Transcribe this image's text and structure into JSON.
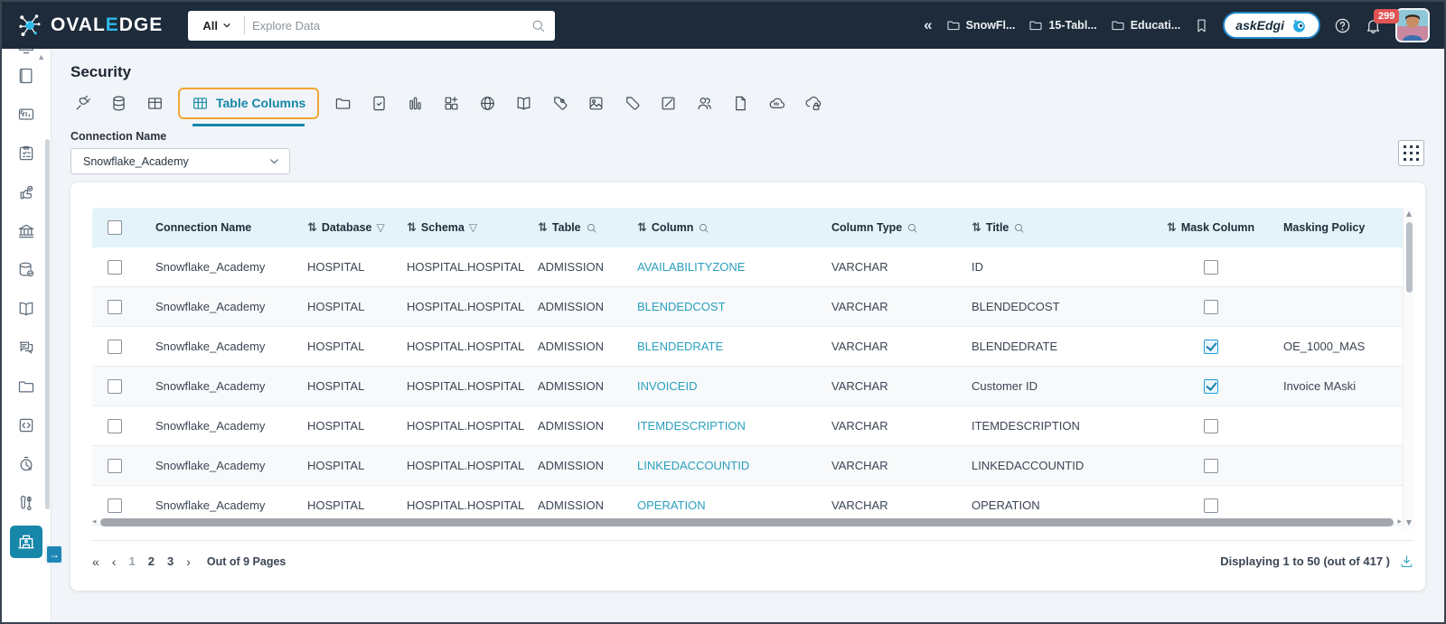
{
  "colors": {
    "accent_teal": "#1687a8",
    "link_teal": "#2a9fbe",
    "topbar_navy": "#1d2b3a",
    "badge_red": "#e25454",
    "annotation_orange": "#f0a632",
    "askedgi_blue": "#1e86c8"
  },
  "topbar": {
    "logo": {
      "part1": "OVAL",
      "accent": "E",
      "part2": "DGE"
    },
    "search": {
      "scope": "All",
      "placeholder": "Explore Data"
    },
    "collapse_glyph": "«",
    "recent": [
      {
        "label": "SnowFl..."
      },
      {
        "label": "15-Tabl..."
      },
      {
        "label": "Educati..."
      }
    ],
    "askedgi_label": "askEdgi",
    "notification_count": "299"
  },
  "sidebar": {
    "icons": [
      "monitor-partial",
      "journal",
      "report",
      "clipboard",
      "approval",
      "institution",
      "database-check",
      "book",
      "comments",
      "folder",
      "code",
      "scheduler",
      "tools",
      "security"
    ],
    "active_icon": "security"
  },
  "page": {
    "title": "Security"
  },
  "tabs": {
    "icons_before": [
      "crawler",
      "database",
      "table"
    ],
    "active": {
      "icon": "table-columns",
      "label": "Table Columns"
    },
    "icons_after": [
      "folder",
      "report-check",
      "bar-chart",
      "blocks-plus",
      "globe",
      "book",
      "tag-badge",
      "image",
      "tag",
      "note",
      "users",
      "file",
      "cloud-api",
      "cloud-lock"
    ]
  },
  "filter": {
    "label": "Connection Name",
    "value": "Snowflake_Academy"
  },
  "table": {
    "headers": {
      "connection": "Connection Name",
      "database": "Database",
      "schema": "Schema",
      "table": "Table",
      "column": "Column",
      "column_type": "Column Type",
      "title": "Title",
      "mask": "Mask Column",
      "masking_policy": "Masking Policy"
    },
    "rows": [
      {
        "connection": "Snowflake_Academy",
        "database": "HOSPITAL",
        "schema": "HOSPITAL.HOSPITAL",
        "table": "ADMISSION",
        "column": "AVAILABILITYZONE",
        "column_type": "VARCHAR",
        "title": "ID",
        "masked": false,
        "masking_policy": ""
      },
      {
        "connection": "Snowflake_Academy",
        "database": "HOSPITAL",
        "schema": "HOSPITAL.HOSPITAL",
        "table": "ADMISSION",
        "column": "BLENDEDCOST",
        "column_type": "VARCHAR",
        "title": "BLENDEDCOST",
        "masked": false,
        "masking_policy": ""
      },
      {
        "connection": "Snowflake_Academy",
        "database": "HOSPITAL",
        "schema": "HOSPITAL.HOSPITAL",
        "table": "ADMISSION",
        "column": "BLENDEDRATE",
        "column_type": "VARCHAR",
        "title": "BLENDEDRATE",
        "masked": true,
        "masking_policy": "OE_1000_MAS"
      },
      {
        "connection": "Snowflake_Academy",
        "database": "HOSPITAL",
        "schema": "HOSPITAL.HOSPITAL",
        "table": "ADMISSION",
        "column": "INVOICEID",
        "column_type": "VARCHAR",
        "title": "Customer ID",
        "masked": true,
        "masking_policy": "Invoice MAski"
      },
      {
        "connection": "Snowflake_Academy",
        "database": "HOSPITAL",
        "schema": "HOSPITAL.HOSPITAL",
        "table": "ADMISSION",
        "column": "ITEMDESCRIPTION",
        "column_type": "VARCHAR",
        "title": "ITEMDESCRIPTION",
        "masked": false,
        "masking_policy": ""
      },
      {
        "connection": "Snowflake_Academy",
        "database": "HOSPITAL",
        "schema": "HOSPITAL.HOSPITAL",
        "table": "ADMISSION",
        "column": "LINKEDACCOUNTID",
        "column_type": "VARCHAR",
        "title": "LINKEDACCOUNTID",
        "masked": false,
        "masking_policy": ""
      },
      {
        "connection": "Snowflake_Academy",
        "database": "HOSPITAL",
        "schema": "HOSPITAL.HOSPITAL",
        "table": "ADMISSION",
        "column": "OPERATION",
        "column_type": "VARCHAR",
        "title": "OPERATION",
        "masked": false,
        "masking_policy": ""
      }
    ]
  },
  "pagination": {
    "first_glyph": "«",
    "prev_glyph": "‹",
    "pages": [
      "1",
      "2",
      "3"
    ],
    "current_page": "1",
    "next_glyph": "›",
    "pages_label": "Out of 9 Pages",
    "displaying": "Displaying 1 to 50  (out of 417 )"
  }
}
